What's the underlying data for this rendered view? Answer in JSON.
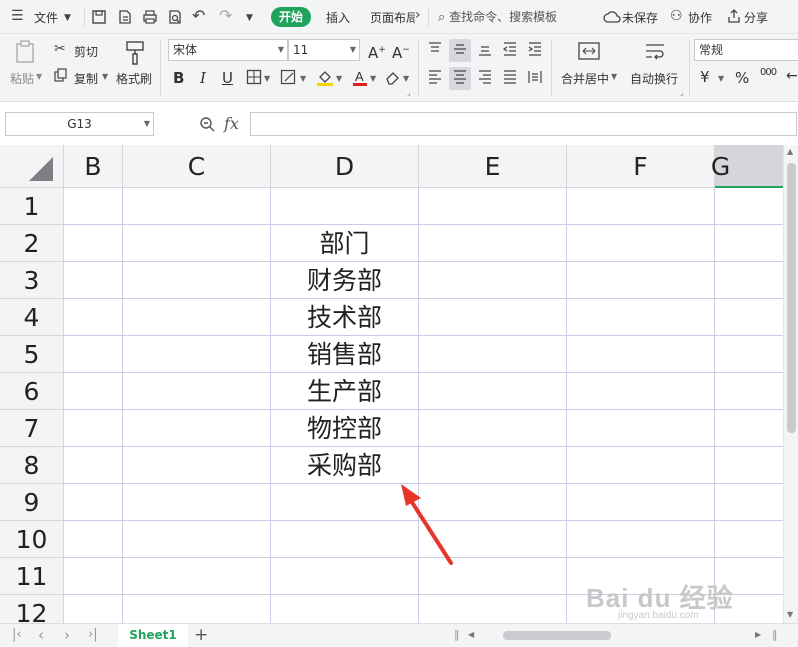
{
  "menu": {
    "file_label": "文件",
    "tabs": [
      "开始",
      "插入",
      "页面布局"
    ],
    "active_tab": "开始",
    "search_placeholder": "查找命令、搜索模板",
    "unsaved_label": "未保存",
    "collab_label": "协作",
    "share_label": "分享"
  },
  "ribbon": {
    "paste_label": "粘贴",
    "cut_label": "剪切",
    "copy_label": "复制",
    "format_painter_label": "格式刷",
    "font_name": "宋体",
    "font_size": "11",
    "merge_center_label": "合并居中",
    "wrap_text_label": "自动换行",
    "number_format": "常规",
    "currency_symbol": "¥",
    "percent_symbol": "%",
    "thousands_symbol": "000",
    "font_color": "#e02020",
    "fill_color": "#f5d300"
  },
  "formula_bar": {
    "cell_ref": "G13",
    "fx_label": "fx",
    "formula_value": ""
  },
  "grid": {
    "columns": [
      "B",
      "C",
      "D",
      "E",
      "F",
      "G"
    ],
    "active_column": "G",
    "rows": [
      "1",
      "2",
      "3",
      "4",
      "5",
      "6",
      "7",
      "8",
      "9",
      "10",
      "11",
      "12"
    ],
    "column_d_values": [
      "",
      "部门",
      "财务部",
      "技术部",
      "销售部",
      "生产部",
      "物控部",
      "采购部",
      "",
      "",
      "",
      ""
    ]
  },
  "sheets": {
    "tabs": [
      "Sheet1"
    ],
    "active": "Sheet1"
  },
  "watermark": {
    "brand": "Bai du 经验",
    "url": "jingyan.baidu.com"
  },
  "colors": {
    "accent": "#1fa35d",
    "arrow": "#e8352a"
  }
}
